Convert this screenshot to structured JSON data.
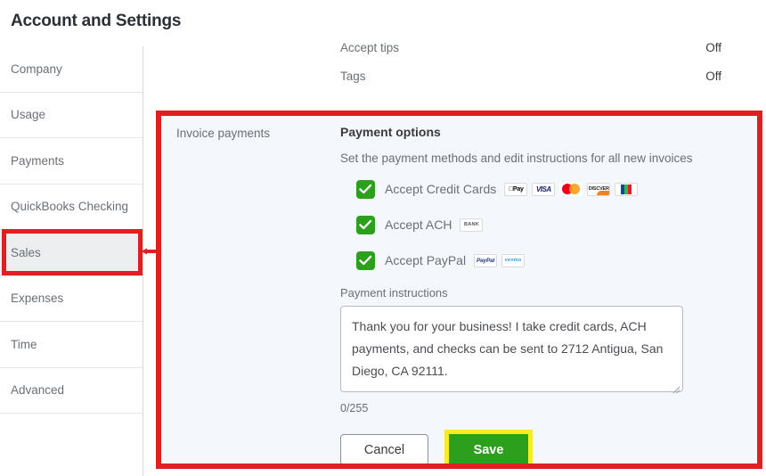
{
  "page": {
    "title": "Account and Settings"
  },
  "sidebar": {
    "items": [
      {
        "label": "Company",
        "selected": false
      },
      {
        "label": "Usage",
        "selected": false
      },
      {
        "label": "Payments",
        "selected": false
      },
      {
        "label": "QuickBooks Checking",
        "selected": false
      },
      {
        "label": "Sales",
        "selected": true
      },
      {
        "label": "Expenses",
        "selected": false
      },
      {
        "label": "Time",
        "selected": false
      },
      {
        "label": "Advanced",
        "selected": false
      }
    ]
  },
  "settings_rows": [
    {
      "label": "Accept tips",
      "value": "Off"
    },
    {
      "label": "Tags",
      "value": "Off"
    }
  ],
  "invoice_payments": {
    "section_label": "Invoice payments",
    "heading": "Payment options",
    "subtitle": "Set the payment methods and edit instructions for all new invoices",
    "options": [
      {
        "label": "Accept Credit Cards",
        "checked": true,
        "logos": [
          "Pay",
          "VISA",
          "mastercard-logo",
          "DISCOVER",
          "jcb-logo"
        ]
      },
      {
        "label": "Accept ACH",
        "checked": true,
        "logos": [
          "BANK"
        ]
      },
      {
        "label": "Accept PayPal",
        "checked": true,
        "logos": [
          "PayPal",
          "venmo"
        ]
      }
    ],
    "instructions": {
      "label": "Payment instructions",
      "value": "Thank you for your business! I take credit cards, ACH payments, and checks can be sent to 2712 Antigua, San Diego, CA 92111.",
      "placeholder": "Payment instructions",
      "counter": "0/255"
    },
    "buttons": {
      "cancel": "Cancel",
      "save": "Save"
    }
  },
  "colors": {
    "annotation_red": "#e02020",
    "highlight_yellow": "#fcec1d",
    "brand_green": "#2ca01c",
    "panel_background": "#f4f7fb",
    "selected_sidebar": "#eceef0"
  }
}
